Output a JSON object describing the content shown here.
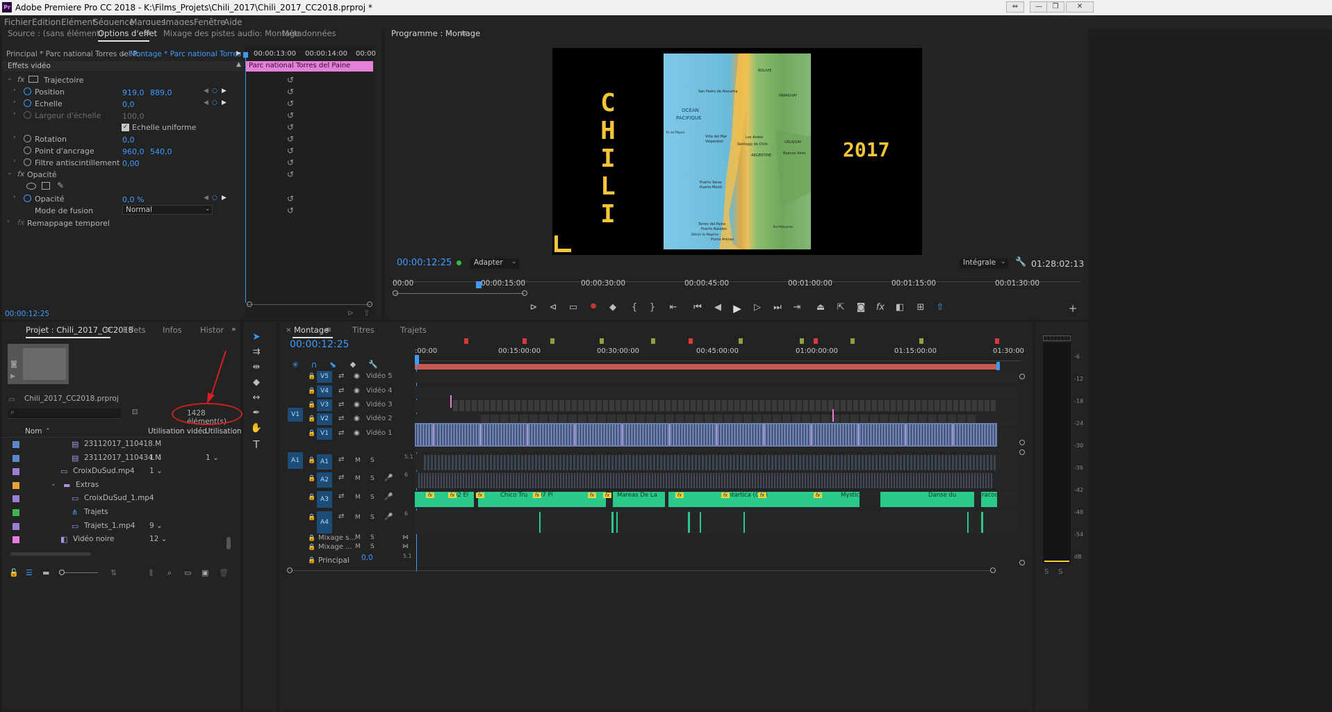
{
  "window": {
    "logo": "Pr",
    "title": "Adobe Premiere Pro CC 2018 - K:\\Films_Projets\\Chili_2017\\Chili_2017_CC2018.prproj *",
    "buttons": [
      "⇔",
      "—",
      "❐",
      "✕"
    ]
  },
  "menu": [
    "Fichier",
    "Edition",
    "Elément",
    "Séquence",
    "Marques",
    "Images",
    "Fenêtre",
    "Aide"
  ],
  "source_tabs": [
    "Source : (sans élément)",
    "Options d'effet",
    "Mixage des pistes audio: Montage",
    "Métadonnées"
  ],
  "effect_controls": {
    "master": "Principal * Parc national Torres del P...",
    "sequence": "Montage * Parc national Torres d...",
    "timecodes": [
      "00:00:13:00",
      "00:00:14:00",
      "00:00"
    ],
    "clip_name": "Parc national Torres del Paine",
    "section": "Effets vidéo",
    "current_time": "00:00:12:25",
    "rows": {
      "trajectoire": "Trajectoire",
      "position": {
        "label": "Position",
        "x": "919,0",
        "y": "889,0"
      },
      "echelle": {
        "label": "Echelle",
        "value": "0,0"
      },
      "largeur": {
        "label": "Largeur d'échelle",
        "value": "100,0"
      },
      "uniforme": "Echelle uniforme",
      "rotation": {
        "label": "Rotation",
        "value": "0,0"
      },
      "ancrage": {
        "label": "Point d'ancrage",
        "x": "960,0",
        "y": "540,0"
      },
      "antiscintillement": {
        "label": "Filtre antiscintillement",
        "value": "0,00"
      },
      "opacite_group": "Opacité",
      "opacite": {
        "label": "Opacité",
        "value": "0,0 %"
      },
      "fusion": {
        "label": "Mode de fusion",
        "value": "Normal"
      },
      "remappage": "Remappage temporel"
    }
  },
  "program": {
    "title": "Programme : Montage",
    "timecode": "00:00:12:25",
    "fit": "Adapter",
    "quality": "Intégrale",
    "duration": "01:28:02:13",
    "ruler": [
      "00:00",
      "00:00:15:00",
      "00:00:30:00",
      "00:00:45:00",
      "00:01:00:00",
      "00:01:15:00",
      "00:01:30:00"
    ],
    "frame": {
      "left_text": "CHILI",
      "right_text": "2017",
      "map_labels": [
        "BOLIVIE",
        "San Pedro de Atacama",
        "PARAGUAY",
        "OCÉAN",
        "PACIFIQUE",
        "Île de Pâques",
        "Viña del Mar",
        "Valparaiso",
        "Los Andes",
        "Santiago de Chile",
        "URUGUAY",
        "ARGENTINE",
        "Buenos Aires",
        "Puerto Varas",
        "Puerto Montt",
        "Torres del Paine",
        "Puerto Natales",
        "Détroit de Magellan",
        "Punta Arenas",
        "Îles Malouines"
      ]
    }
  },
  "project": {
    "tabs": [
      "Projet : Chili_2017_CC2018",
      "Effets",
      "Infos",
      "Histor"
    ],
    "file": "Chili_2017_CC2018.prproj",
    "count": "1428 élément(s)",
    "columns": [
      "Nom",
      "Utilisation vidéo",
      "Utilisation"
    ],
    "items": [
      {
        "name": "23112017_110418.M",
        "color": "#5b86c8",
        "usage": "",
        "usage2": "",
        "indent": 2,
        "type": "seq"
      },
      {
        "name": "23112017_110434.M",
        "color": "#5b86c8",
        "usage": "1",
        "usage2": "1",
        "indent": 2,
        "type": "seq"
      },
      {
        "name": "CroixDuSud.mp4",
        "color": "#9b7fd6",
        "usage": "1",
        "usage2": "",
        "indent": 1,
        "type": "clip"
      },
      {
        "name": "Extras",
        "color": "#e8a23a",
        "usage": "",
        "usage2": "",
        "indent": 1,
        "type": "folder"
      },
      {
        "name": "CroixDuSud_1.mp4",
        "color": "#9b7fd6",
        "usage": "",
        "usage2": "",
        "indent": 2,
        "type": "clip"
      },
      {
        "name": "Trajets",
        "color": "#3fb34f",
        "usage": "",
        "usage2": "",
        "indent": 2,
        "type": "seq2"
      },
      {
        "name": "Trajets_1.mp4",
        "color": "#9b7fd6",
        "usage": "9",
        "usage2": "",
        "indent": 2,
        "type": "clip"
      },
      {
        "name": "Vidéo noire",
        "color": "#e97de0",
        "usage": "12",
        "usage2": "",
        "indent": 1,
        "type": "black"
      }
    ]
  },
  "timeline": {
    "tabs": [
      "Montage",
      "Titres",
      "Trajets"
    ],
    "timecode": "00:00:12:25",
    "ruler": [
      ":00:00",
      "00:15:00:00",
      "00:30:00:00",
      "00:45:00:00",
      "01:00:00:00",
      "01:15:00:00",
      "01:30:00"
    ],
    "video_tracks": [
      {
        "id": "V5",
        "name": "Vidéo 5"
      },
      {
        "id": "V4",
        "name": "Vidéo 4"
      },
      {
        "id": "V3",
        "name": "Vidéo 3"
      },
      {
        "id": "V2",
        "name": "Vidéo 2"
      },
      {
        "id": "V1",
        "name": "Vidéo 1"
      }
    ],
    "audio_tracks": [
      {
        "id": "A1",
        "ch": "5.1"
      },
      {
        "id": "A2",
        "ch": "6"
      },
      {
        "id": "A3",
        "ch": ""
      },
      {
        "id": "A4",
        "ch": "6"
      }
    ],
    "src_v": "V1",
    "src_a": "A1",
    "mixes": [
      "Mixage s...",
      "Mixage ..."
    ],
    "master": {
      "label": "Principal",
      "value": "0,0",
      "ch": "5.1"
    },
    "audio_clip_names": [
      "02 El",
      "Chico Tru",
      "07 Pi",
      "Mareas De La",
      "Antartica (Ost)",
      "Mystic Te",
      "Danse du",
      "Viracoc"
    ],
    "meter_scale": [
      "-6",
      "-12",
      "-18",
      "-24",
      "-30",
      "-36",
      "-42",
      "-48",
      "-54",
      "dB"
    ]
  }
}
